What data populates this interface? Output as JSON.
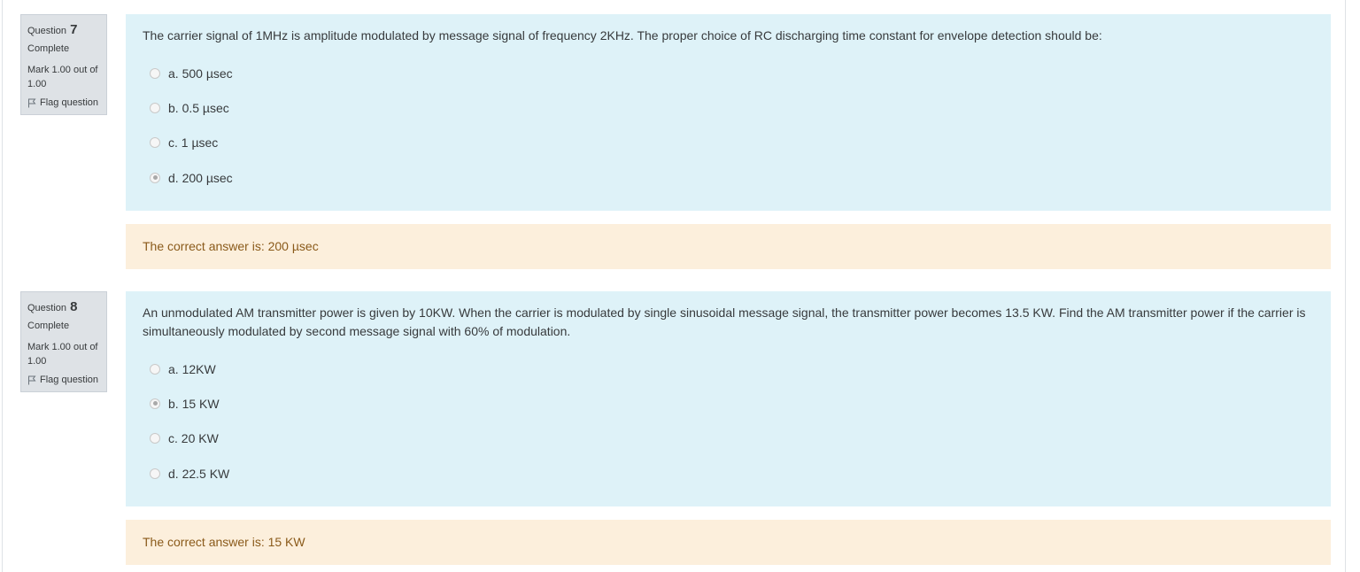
{
  "questions": [
    {
      "label": "Question",
      "number": "7",
      "state": "Complete",
      "grade": "Mark 1.00 out of 1.00",
      "flag_label": "Flag question",
      "text": "The carrier signal of 1MHz is amplitude modulated by message signal of frequency 2KHz. The proper choice of RC discharging time constant for envelope detection should be:",
      "options": [
        {
          "label": "a. 500 µsec",
          "selected": false
        },
        {
          "label": "b. 0.5 µsec",
          "selected": false
        },
        {
          "label": "c. 1 µsec",
          "selected": false
        },
        {
          "label": "d. 200 µsec",
          "selected": true
        }
      ],
      "feedback": "The correct answer is: 200 µsec"
    },
    {
      "label": "Question",
      "number": "8",
      "state": "Complete",
      "grade": "Mark 1.00 out of 1.00",
      "flag_label": "Flag question",
      "text": "An unmodulated AM transmitter power is given by 10KW. When the carrier is modulated by single sinusoidal message signal, the transmitter power becomes 13.5 KW. Find the AM transmitter power if the carrier is simultaneously modulated by second message signal with 60% of modulation.",
      "options": [
        {
          "label": "a. 12KW",
          "selected": false
        },
        {
          "label": "b. 15 KW",
          "selected": true
        },
        {
          "label": "c. 20 KW",
          "selected": false
        },
        {
          "label": "d. 22.5 KW",
          "selected": false
        }
      ],
      "feedback": "The correct answer is: 15 KW"
    }
  ]
}
